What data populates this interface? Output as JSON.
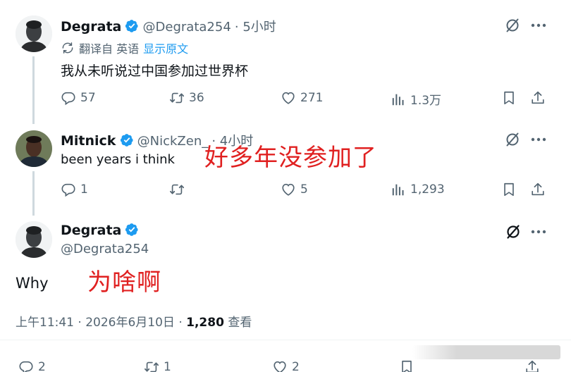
{
  "tweets": [
    {
      "display_name": "Degrata",
      "handle": "@Degrata254",
      "time": "· 5小时",
      "translate_note": "翻译自 英语",
      "show_original": "显示原文",
      "text": "我从未听说过中国参加过世界杯",
      "replies": "57",
      "retweets": "36",
      "likes": "271",
      "views": "1.3万"
    },
    {
      "display_name": "Mitnick",
      "handle": "@NickZen_",
      "time": "· 4小时",
      "text": "been years i think",
      "replies": "1",
      "retweets": "",
      "likes": "5",
      "views": "1,293",
      "overlay": "好多年没参加了"
    }
  ],
  "main_tweet": {
    "display_name": "Degrata",
    "handle": "@Degrata254",
    "text": "Why",
    "overlay": "为啥啊",
    "timestamp": "上午11:41 · 2026年6月10日 · ",
    "view_count": "1,280",
    "views_label": " 查看",
    "replies": "2",
    "retweets": "1",
    "likes": "2"
  },
  "icons": [
    "verified-badge-icon",
    "grok-icon",
    "more-icon",
    "translate-icon",
    "reply-icon",
    "retweet-icon",
    "like-icon",
    "views-icon",
    "bookmark-icon",
    "share-icon"
  ],
  "colors": {
    "verified": "#1d9bf0",
    "link": "#1d9bf0",
    "muted": "#536471",
    "overlay_red": "#e02020"
  }
}
